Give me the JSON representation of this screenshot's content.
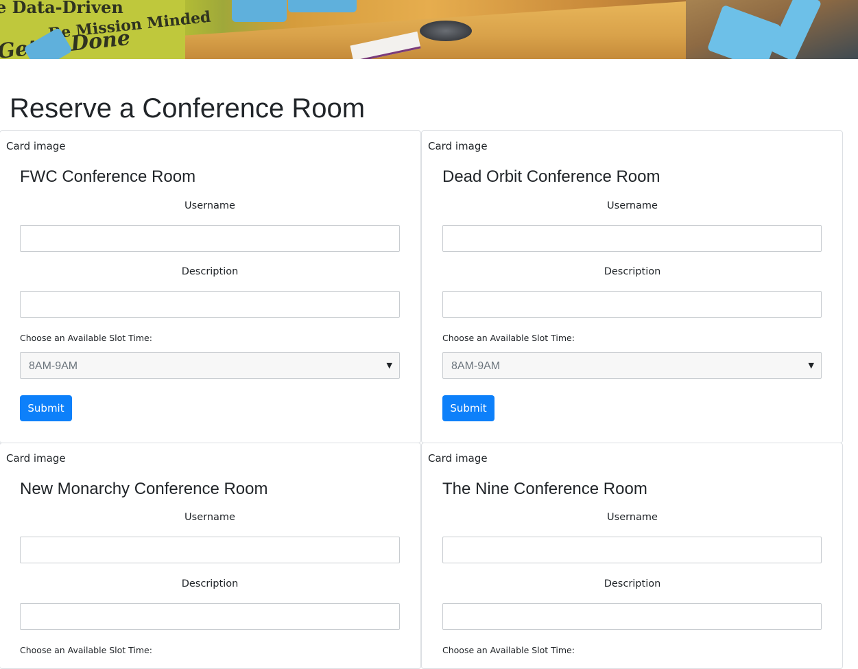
{
  "banner": {
    "wall_text_1": "e Data-Driven",
    "wall_text_2": "Be Mission Minded",
    "wall_text_3": "Get It Done"
  },
  "page": {
    "title": "Reserve a Conference Room"
  },
  "rooms": [
    {
      "image_alt": "Card image",
      "title": "FWC Conference Room",
      "username_label": "Username",
      "username_value": "",
      "description_label": "Description",
      "description_value": "",
      "slot_label": "Choose an Available Slot Time:",
      "slot_value": "8AM-9AM",
      "submit_label": "Submit"
    },
    {
      "image_alt": "Card image",
      "title": "Dead Orbit Conference Room",
      "username_label": "Username",
      "username_value": "",
      "description_label": "Description",
      "description_value": "",
      "slot_label": "Choose an Available Slot Time:",
      "slot_value": "8AM-9AM",
      "submit_label": "Submit"
    },
    {
      "image_alt": "Card image",
      "title": "New Monarchy Conference Room",
      "username_label": "Username",
      "username_value": "",
      "description_label": "Description",
      "description_value": "",
      "slot_label": "Choose an Available Slot Time:"
    },
    {
      "image_alt": "Card image",
      "title": "The Nine Conference Room",
      "username_label": "Username",
      "username_value": "",
      "description_label": "Description",
      "description_value": "",
      "slot_label": "Choose an Available Slot Time:"
    }
  ],
  "theme": {
    "primary": "#0d80fa",
    "text": "#212529",
    "border": "#dcdfe3"
  },
  "icons": {
    "select_arrow": "chevron-down-icon"
  }
}
